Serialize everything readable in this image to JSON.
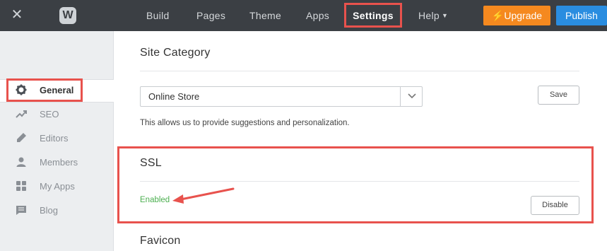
{
  "topbar": {
    "close_icon": "close-icon",
    "logo_letter": "W",
    "nav": [
      "Build",
      "Pages",
      "Theme",
      "Apps",
      "Settings",
      "Help"
    ],
    "upgrade_label": "Upgrade",
    "publish_label": "Publish"
  },
  "sidebar": {
    "items": [
      {
        "label": "General",
        "icon": "gear-icon",
        "active": true
      },
      {
        "label": "SEO",
        "icon": "trend-icon"
      },
      {
        "label": "Editors",
        "icon": "pencil-icon"
      },
      {
        "label": "Members",
        "icon": "person-icon"
      },
      {
        "label": "My Apps",
        "icon": "grid-icon"
      },
      {
        "label": "Blog",
        "icon": "chat-icon"
      }
    ]
  },
  "main": {
    "site_category": {
      "title": "Site Category",
      "selected": "Online Store",
      "save_label": "Save",
      "help": "This allows us to provide suggestions and personalization."
    },
    "ssl": {
      "title": "SSL",
      "status": "Enabled",
      "disable_label": "Disable"
    },
    "favicon": {
      "title": "Favicon"
    }
  },
  "colors": {
    "topbar": "#3b3f44",
    "upgrade": "#f5891f",
    "publish": "#2a8de0",
    "highlight": "#e8524d",
    "enabled": "#4caf50"
  }
}
